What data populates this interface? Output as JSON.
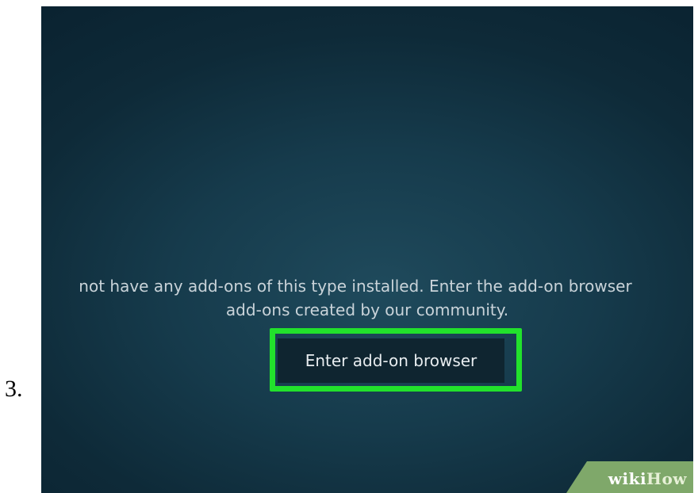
{
  "step": {
    "number": "3."
  },
  "screen": {
    "message_line1": "not have any add-ons of this type installed. Enter the add-on browser",
    "message_line2": "add-ons created by our community.",
    "button_label": "Enter add-on browser"
  },
  "watermark": {
    "wiki": "wiki",
    "how": "How"
  },
  "colors": {
    "highlight": "#22e12c",
    "background": "#163b4c",
    "badge": "#7fa86a"
  }
}
